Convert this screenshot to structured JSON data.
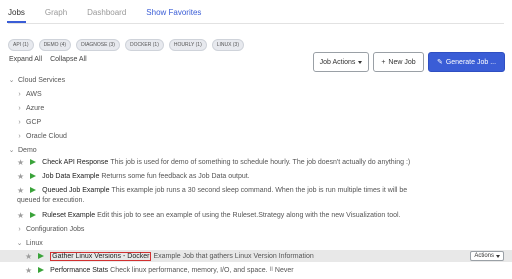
{
  "tabs": {
    "jobs": "Jobs",
    "graph": "Graph",
    "dashboard": "Dashboard",
    "favorites": "Show Favorites"
  },
  "chips": [
    "API (1)",
    "DEMO (4)",
    "DIAGNOSE (3)",
    "DOCKER (1)",
    "HOURLY (1)",
    "LINUX (3)"
  ],
  "expand_all": "Expand All",
  "collapse_all": "Collapse All",
  "buttons": {
    "job_actions": "Job Actions",
    "new_job": "New Job",
    "new_job_icon": "+",
    "generate_job": "Generate Job ...",
    "generate_icon": "✎"
  },
  "tree": {
    "cloud_services": "Cloud Services",
    "aws": "AWS",
    "azure": "Azure",
    "gcp": "GCP",
    "oracle_cloud": "Oracle Cloud",
    "demo": "Demo",
    "configuration_jobs": "Configuration Jobs",
    "linux": "Linux"
  },
  "jobs": {
    "check_api": {
      "name": "Check API Response",
      "desc": "This job is used for demo of something to schedule hourly. The job doesn't actually do anything :)"
    },
    "job_data": {
      "name": "Job Data Example",
      "desc": "Returns some fun feedback as Job Data output."
    },
    "queued": {
      "name": "Queued Job Example",
      "desc": "This example job runs a 30 second sleep command. When the job is run multiple times it will be",
      "cont": "queued for execution."
    },
    "ruleset": {
      "name": "Ruleset Example",
      "desc": "Edit this job to see an example of using the Ruleset.Strategy along with the new Visualization tool."
    },
    "gather": {
      "name": "Gather Linux Versions - Docker",
      "desc": "Example Job that gathers Linux Version Information",
      "actions": "Actions"
    },
    "perf": {
      "name": "Performance Stats",
      "desc": "Check linux performance, memory, I/O, and space.",
      "pause": "II",
      "never": "Never"
    }
  },
  "icons": {
    "star": "star-icon",
    "play": "play-icon",
    "chev_right": "chevron-right-icon",
    "chev_down": "chevron-down-icon"
  },
  "colors": {
    "accent": "#3a5dd6",
    "play": "#3aa33a",
    "highlight_border": "#d23030"
  }
}
